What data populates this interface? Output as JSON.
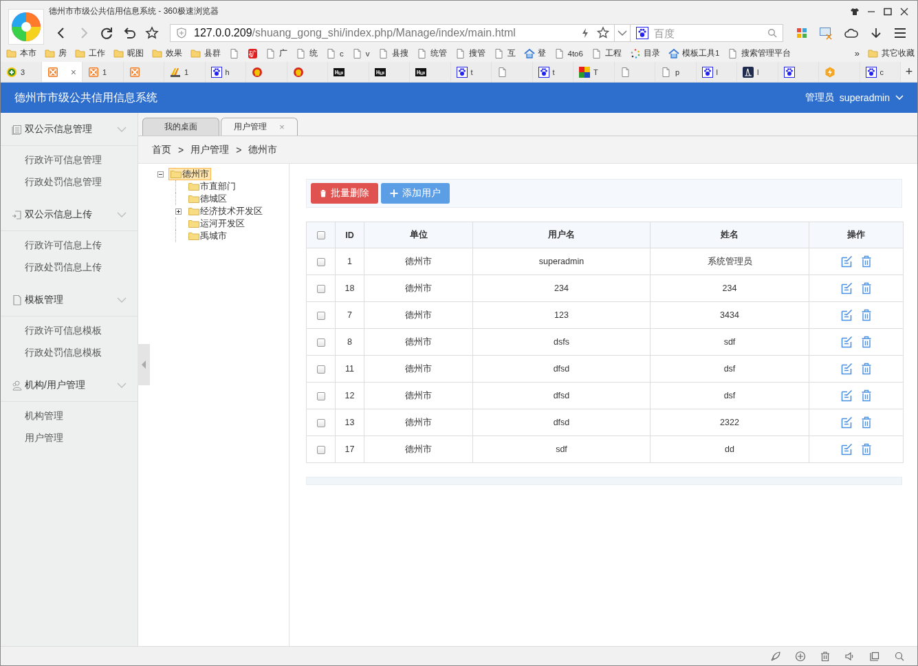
{
  "browser": {
    "title": "德州市市级公共信用信息系统 - 360极速浏览器",
    "url_host": "127.0.0.209",
    "url_path": "/shuang_gong_shi/index.php/Manage/index/main.html",
    "search_placeholder": "百度"
  },
  "bookmarks": [
    {
      "kind": "folder",
      "label": "本市"
    },
    {
      "kind": "folder",
      "label": "房"
    },
    {
      "kind": "folder",
      "label": "工作"
    },
    {
      "kind": "folder",
      "label": "昵图"
    },
    {
      "kind": "folder",
      "label": "效果"
    },
    {
      "kind": "folder",
      "label": "县群"
    },
    {
      "kind": "page"
    },
    {
      "kind": "badge",
      "badge": "矿"
    },
    {
      "kind": "page",
      "label": "广"
    },
    {
      "kind": "page",
      "label": "统"
    },
    {
      "kind": "page",
      "label": "c"
    },
    {
      "kind": "page",
      "label": "v"
    },
    {
      "kind": "page",
      "label": "县搜"
    },
    {
      "kind": "page",
      "label": "统管"
    },
    {
      "kind": "page",
      "label": "搜管"
    },
    {
      "kind": "page",
      "label": "互"
    },
    {
      "kind": "home",
      "label": "登"
    },
    {
      "kind": "page",
      "label": "4to6"
    },
    {
      "kind": "page",
      "label": "工程"
    },
    {
      "kind": "dots",
      "label": "目录"
    },
    {
      "kind": "home",
      "label": "模板工具1"
    },
    {
      "kind": "page",
      "label": "搜索管理平台"
    }
  ],
  "bookmarks_more": "»",
  "other_bookmarks": "其它收藏",
  "browser_tabs": [
    {
      "kind": "plus-circle",
      "label": "3",
      "selected": false
    },
    {
      "kind": "xampp",
      "selected": true,
      "close": "×"
    },
    {
      "kind": "xampp",
      "label": "1",
      "selected": false
    },
    {
      "kind": "xampp",
      "selected": false
    },
    {
      "kind": "pma",
      "label": "1",
      "selected": false
    },
    {
      "kind": "paw",
      "label": "h",
      "selected": false
    },
    {
      "kind": "emblem",
      "selected": false
    },
    {
      "kind": "emblem",
      "selected": false
    },
    {
      "kind": "hui",
      "selected": false
    },
    {
      "kind": "hui",
      "selected": false
    },
    {
      "kind": "hui",
      "selected": false
    },
    {
      "kind": "paw",
      "label": "t",
      "selected": false
    },
    {
      "kind": "page",
      "selected": false
    },
    {
      "kind": "paw",
      "label": "t",
      "selected": false
    },
    {
      "kind": "mosaic",
      "label": "T",
      "selected": false
    },
    {
      "kind": "page",
      "selected": false
    },
    {
      "kind": "page",
      "label": "p",
      "selected": false
    },
    {
      "kind": "paw",
      "label": "l",
      "selected": false
    },
    {
      "kind": "dark",
      "label": "l",
      "selected": false
    },
    {
      "kind": "paw",
      "selected": false
    },
    {
      "kind": "bolt",
      "selected": false
    },
    {
      "kind": "paw",
      "label": "c",
      "selected": false
    }
  ],
  "new_tab": "+",
  "app": {
    "title": "德州市市级公共信用信息系统",
    "role": "管理员",
    "user": "superadmin"
  },
  "sidebar": [
    {
      "label": "双公示信息管理",
      "kind": "list",
      "expanded": true,
      "children": [
        {
          "label": "行政许可信息管理"
        },
        {
          "label": "行政处罚信息管理"
        }
      ]
    },
    {
      "label": "双公示信息上传",
      "kind": "upload",
      "expanded": true,
      "children": [
        {
          "label": "行政许可信息上传"
        },
        {
          "label": "行政处罚信息上传"
        }
      ]
    },
    {
      "label": "模板管理",
      "kind": "page",
      "expanded": true,
      "children": [
        {
          "label": "行政许可信息模板"
        },
        {
          "label": "行政处罚信息模板"
        }
      ]
    },
    {
      "label": "机构/用户管理",
      "kind": "users",
      "expanded": true,
      "children": [
        {
          "label": "机构管理"
        },
        {
          "label": "用户管理"
        }
      ]
    }
  ],
  "page_tabs": [
    {
      "label": "我的桌面",
      "selected": false
    },
    {
      "label": "用户管理",
      "selected": true,
      "close": "×"
    }
  ],
  "breadcrumb": [
    "首页",
    ">",
    "用户管理",
    ">",
    "德州市"
  ],
  "tree": [
    {
      "label": "德州市",
      "selected": true,
      "expanded": true,
      "children": [
        {
          "label": "市直部门",
          "selected": false
        },
        {
          "label": "德城区",
          "selected": false
        },
        {
          "label": "经济技术开发区",
          "selected": false,
          "expanded": false
        },
        {
          "label": "运河开发区",
          "selected": false
        },
        {
          "label": "禹城市",
          "selected": false
        }
      ]
    }
  ],
  "actions": [
    {
      "kind": "danger",
      "label": "批量删除"
    },
    {
      "kind": "primary",
      "label": "添加用户"
    }
  ],
  "table": {
    "header_checked": false,
    "columns": [
      "ID",
      "单位",
      "用户名",
      "姓名",
      "操作"
    ],
    "rows": [
      {
        "checked": false,
        "cells": [
          "1",
          "德州市",
          "superadmin",
          "系统管理员"
        ]
      },
      {
        "checked": false,
        "cells": [
          "18",
          "德州市",
          "234",
          "234"
        ]
      },
      {
        "checked": false,
        "cells": [
          "7",
          "德州市",
          "123",
          "3434"
        ]
      },
      {
        "checked": false,
        "cells": [
          "8",
          "德州市",
          "dsfs",
          "sdf"
        ]
      },
      {
        "checked": false,
        "cells": [
          "11",
          "德州市",
          "dfsd",
          "dsf"
        ]
      },
      {
        "checked": false,
        "cells": [
          "12",
          "德州市",
          "dfsd",
          "dsf"
        ]
      },
      {
        "checked": false,
        "cells": [
          "13",
          "德州市",
          "dfsd",
          "2322"
        ]
      },
      {
        "checked": false,
        "cells": [
          "17",
          "德州市",
          "sdf",
          "dd"
        ]
      }
    ]
  }
}
